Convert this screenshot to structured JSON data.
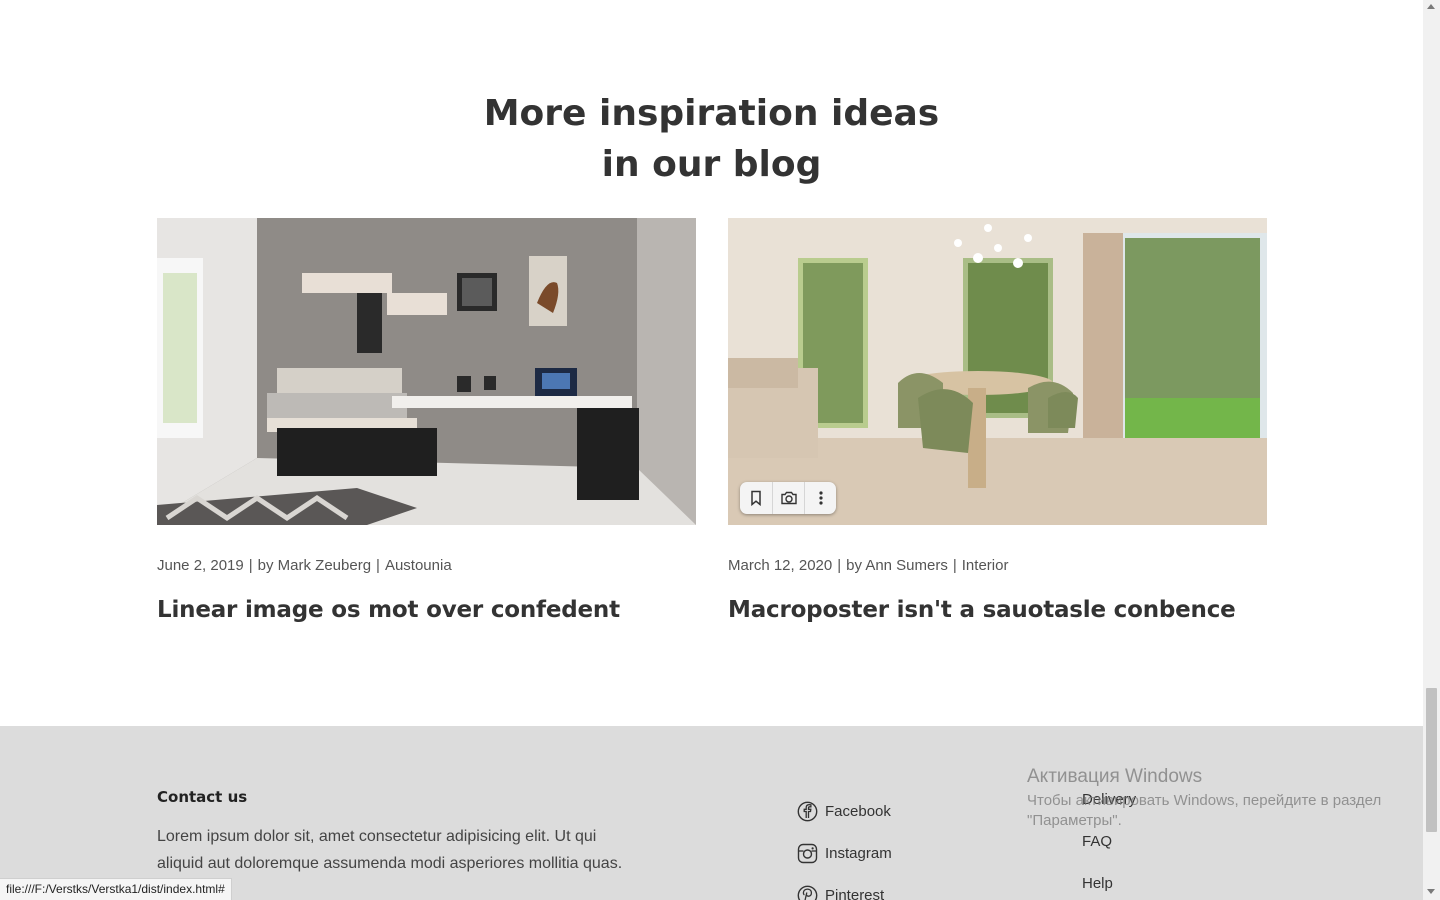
{
  "blog": {
    "title_line1": "More inspiration ideas",
    "title_line2": "in our blog",
    "posts": [
      {
        "date": "June 2, 2019",
        "author": "by Mark Zeuberg",
        "category": "Austounia",
        "title": "Linear image os mot over confedent",
        "image": "bedroom-with-desk-photo"
      },
      {
        "date": "March 12, 2020",
        "author": "by Ann Sumers",
        "category": "Interior",
        "title": "Macroposter isn't a sauotasle conbence",
        "image": "dining-room-photo"
      }
    ],
    "separator": "|"
  },
  "image_toolbar": {
    "icons": [
      "bookmark-icon",
      "camera-search-icon",
      "more-vertical-icon"
    ]
  },
  "footer": {
    "contact_heading": "Contact us",
    "contact_text": "Lorem ipsum dolor sit, amet consectetur adipisicing elit. Ut qui aliquid aut doloremque assumenda modi asperiores mollitia quas.",
    "social": [
      {
        "label": "Facebook",
        "icon": "facebook-icon"
      },
      {
        "label": "Instagram",
        "icon": "instagram-icon"
      },
      {
        "label": "Pinterest",
        "icon": "pinterest-icon"
      }
    ],
    "links": [
      "Delivery",
      "FAQ",
      "Help"
    ],
    "background": "#dcdcdc"
  },
  "windows_overlay": {
    "title": "Активация Windows",
    "text": "Чтобы активировать Windows, перейдите в раздел \"Параметры\"."
  },
  "status_bar": {
    "url": "file:///F:/Verstks/Verstka1/dist/index.html#"
  }
}
